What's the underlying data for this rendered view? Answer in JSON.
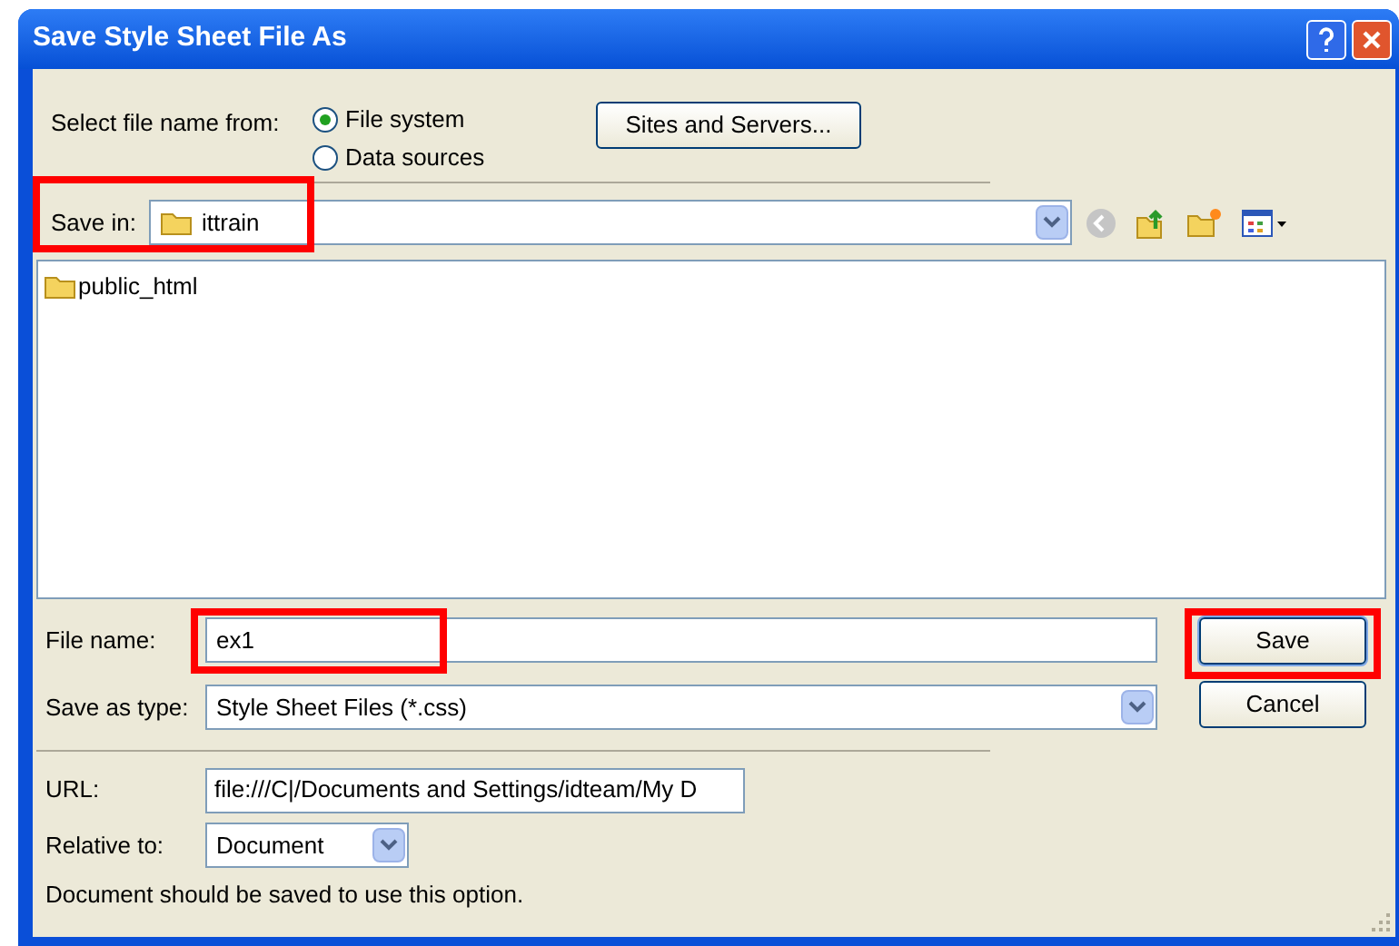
{
  "window": {
    "title": "Save Style Sheet File As"
  },
  "select_from": {
    "label": "Select file name from:",
    "options": [
      {
        "label": "File system",
        "selected": true
      },
      {
        "label": "Data sources",
        "selected": false
      }
    ]
  },
  "sites_button": "Sites and Servers...",
  "save_in": {
    "label": "Save in:",
    "value": "ittrain",
    "highlighted": true
  },
  "files": [
    {
      "name": "public_html"
    }
  ],
  "file_name": {
    "label": "File name:",
    "value": "ex1",
    "highlighted": true
  },
  "save_as_type": {
    "label": "Save as type:",
    "value": "Style Sheet Files (*.css)"
  },
  "buttons": [
    {
      "label": "Save",
      "highlighted": true
    },
    {
      "label": "Cancel",
      "highlighted": false
    }
  ],
  "url": {
    "label": "URL:",
    "value": "file:///C|/Documents and Settings/idteam/My D"
  },
  "relative_to": {
    "label": "Relative to:",
    "value": "Document"
  },
  "note": "Document should be saved to use this option."
}
